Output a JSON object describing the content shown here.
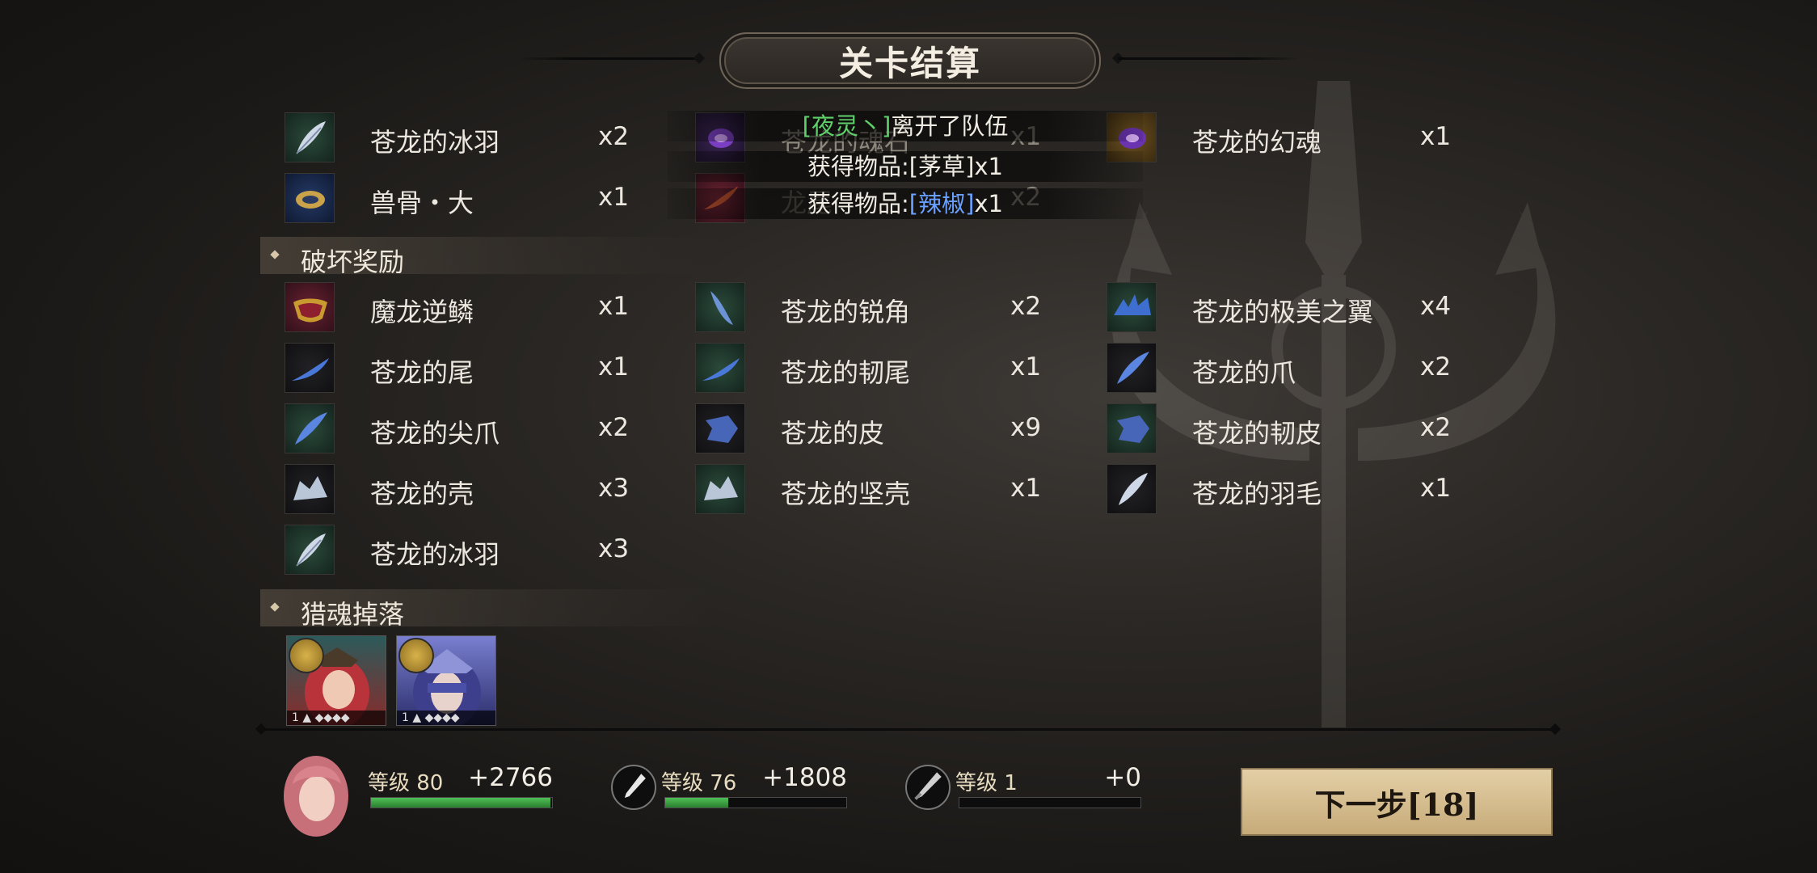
{
  "header": {
    "title": "关卡结算"
  },
  "notice": {
    "line1_name": "[夜灵丶]",
    "line1_text": "离开了队伍",
    "line2_prefix": "获得物品:",
    "line2_item": "[茅草]",
    "line2_qty": "x1",
    "line3_prefix": "获得物品:",
    "line3_item": "[辣椒]",
    "line3_qty": "x1"
  },
  "top_items": [
    {
      "name": "苍龙的冰羽",
      "qty": "x2",
      "icon": "feather-icon"
    },
    {
      "name": "苍龙的魂石",
      "qty": "x1",
      "icon": "soul-orb-icon"
    },
    {
      "name": "苍龙的幻魂",
      "qty": "x1",
      "icon": "soul-orb-icon"
    },
    {
      "name": "兽骨・大",
      "qty": "x1",
      "icon": "bone-icon"
    },
    {
      "name": "龙尾",
      "qty": "x2",
      "icon": "tail-icon"
    }
  ],
  "sections": {
    "destroy": "破坏奖励",
    "hunt": "猎魂掉落"
  },
  "destroy_items": [
    {
      "name": "魔龙逆鳞",
      "qty": "x1",
      "icon": "scale-icon"
    },
    {
      "name": "苍龙的锐角",
      "qty": "x2",
      "icon": "horn-icon"
    },
    {
      "name": "苍龙的极美之翼",
      "qty": "x4",
      "icon": "wing-icon"
    },
    {
      "name": "苍龙的尾",
      "qty": "x1",
      "icon": "tail-icon"
    },
    {
      "name": "苍龙的韧尾",
      "qty": "x1",
      "icon": "tail-icon"
    },
    {
      "name": "苍龙的爪",
      "qty": "x2",
      "icon": "claw-icon"
    },
    {
      "name": "苍龙的尖爪",
      "qty": "x2",
      "icon": "claw-icon"
    },
    {
      "name": "苍龙的皮",
      "qty": "x9",
      "icon": "hide-icon"
    },
    {
      "name": "苍龙的韧皮",
      "qty": "x2",
      "icon": "hide-icon"
    },
    {
      "name": "苍龙的壳",
      "qty": "x3",
      "icon": "shell-icon"
    },
    {
      "name": "苍龙的坚壳",
      "qty": "x1",
      "icon": "shell-icon"
    },
    {
      "name": "苍龙的羽毛",
      "qty": "x1",
      "icon": "feather-icon"
    },
    {
      "name": "苍龙的冰羽",
      "qty": "x3",
      "icon": "feather-icon"
    }
  ],
  "hunt_souls": [
    {
      "level": "1",
      "icon": "red-hair-character-portrait"
    },
    {
      "level": "1",
      "icon": "blindfolded-character-portrait"
    }
  ],
  "stats": [
    {
      "label": "等级 80",
      "exp": "+2766",
      "progress": 0.99,
      "icon": "player-avatar"
    },
    {
      "label": "等级 76",
      "exp": "+1808",
      "progress": 0.35,
      "icon": "brush-weapon-icon"
    },
    {
      "label": "等级 1",
      "exp": "+0",
      "progress": 0.0,
      "icon": "dagger-weapon-icon"
    }
  ],
  "next_button": {
    "label": "下一步[18]"
  }
}
